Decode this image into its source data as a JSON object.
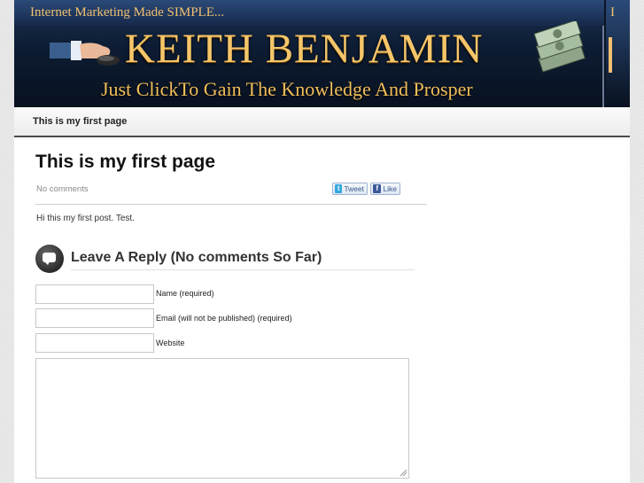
{
  "header": {
    "tagline": "Internet Marketing Made SIMPLE...",
    "name": "KEITH BENJAMIN",
    "subtitle": "Just ClickTo Gain The Knowledge And Prosper",
    "right_glyph": "I"
  },
  "nav": {
    "items": [
      {
        "label": "This is my first page"
      }
    ]
  },
  "post": {
    "title": "This is my first page",
    "meta": "No comments",
    "tweet_label": "Tweet",
    "like_label": "Like",
    "body": "Hi this my first post. Test."
  },
  "reply": {
    "title": "Leave A Reply (No comments So Far)",
    "fields": {
      "name_label": "Name (required)",
      "email_label": "Email (will not be published) (required)",
      "website_label": "Website"
    }
  },
  "icons": {
    "reply": "comment-bubble-icon",
    "tweet": "twitter-bird-icon",
    "like": "facebook-f-icon"
  }
}
